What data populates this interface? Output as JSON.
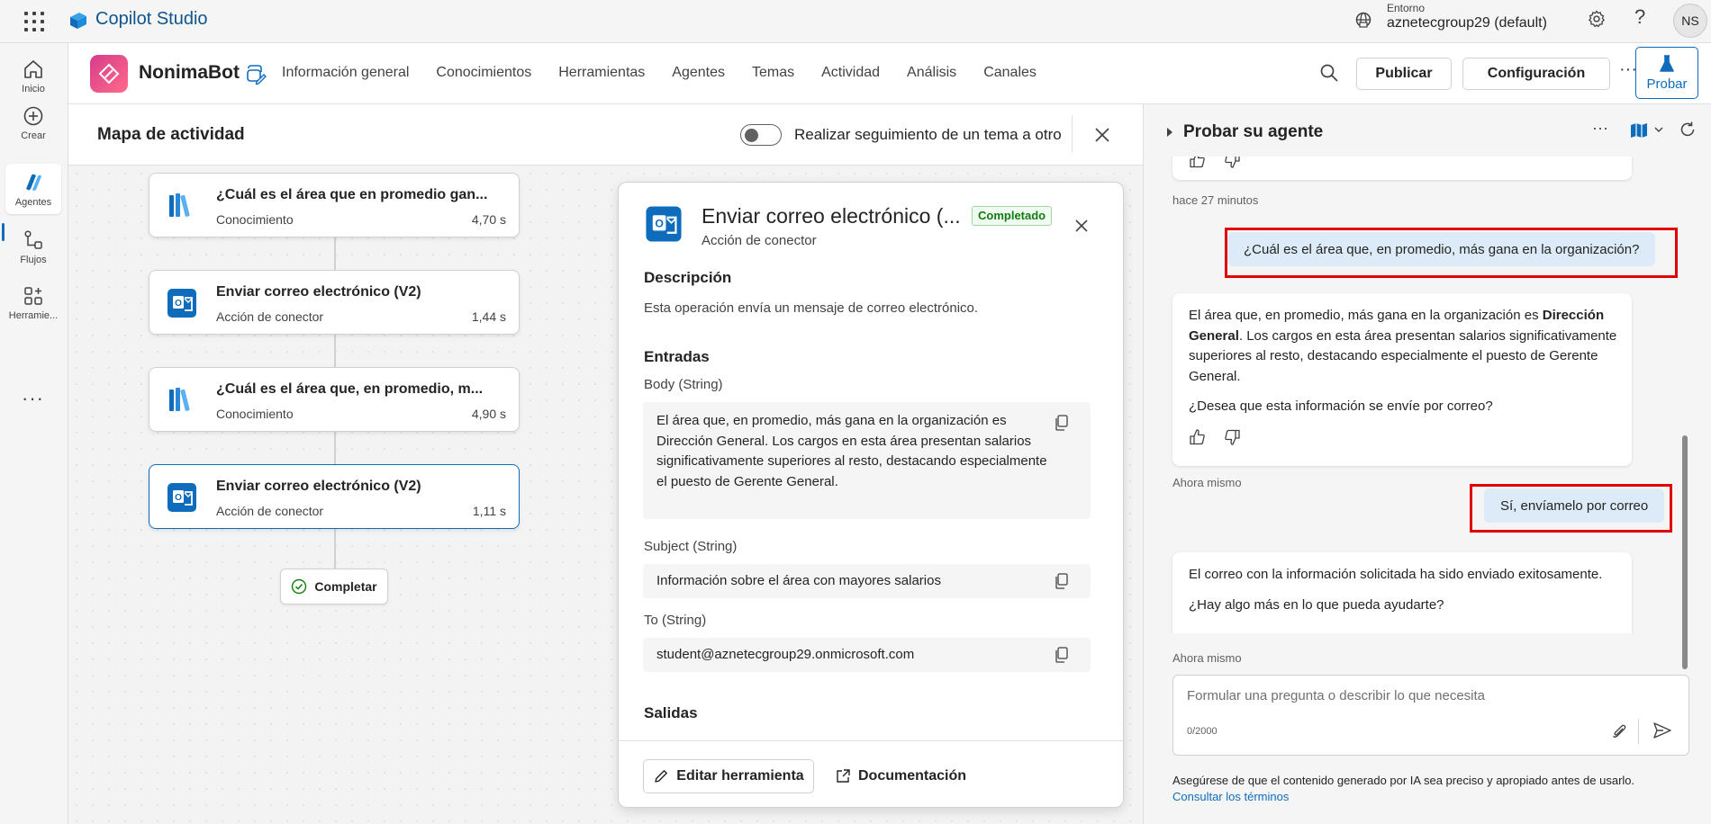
{
  "app": {
    "title": "Copilot Studio",
    "environment_label": "Entorno",
    "environment_value": "aznetecgroup29 (default)",
    "user_initials": "NS"
  },
  "rail": {
    "items": [
      {
        "label": "Inicio",
        "icon": "home-icon"
      },
      {
        "label": "Crear",
        "icon": "add-circle-icon"
      },
      {
        "label": "Agentes",
        "icon": "copilot-icon"
      },
      {
        "label": "Flujos",
        "icon": "flow-icon"
      },
      {
        "label": "Herramie...",
        "icon": "tools-icon"
      }
    ],
    "more": "···"
  },
  "agent": {
    "name": "NonimaBot",
    "nav": [
      "Información general",
      "Conocimientos",
      "Herramientas",
      "Agentes",
      "Temas",
      "Actividad",
      "Análisis",
      "Canales"
    ],
    "publish_label": "Publicar",
    "config_label": "Configuración",
    "more": "···",
    "test_label": "Probar"
  },
  "activity": {
    "title": "Mapa de actividad",
    "toggle_label": "Realizar seguimiento de un tema a otro",
    "toggle_on": false,
    "steps": [
      {
        "title": "¿Cuál es el área que en promedio gan...",
        "type": "Conocimiento",
        "time": "4,70 s",
        "icon": "knowledge-books-icon"
      },
      {
        "title": "Enviar correo electrónico (V2)",
        "type": "Acción de conector",
        "time": "1,44 s",
        "icon": "outlook-icon"
      },
      {
        "title": "¿Cuál es el área que, en promedio, m...",
        "type": "Conocimiento",
        "time": "4,90 s",
        "icon": "knowledge-books-icon"
      },
      {
        "title": "Enviar correo electrónico (V2)",
        "type": "Acción de conector",
        "time": "1,11 s",
        "icon": "outlook-icon"
      }
    ],
    "complete_label": "Completar"
  },
  "detail": {
    "title": "Enviar correo electrónico (...",
    "badge": "Completado",
    "subtitle": "Acción de conector",
    "description_heading": "Descripción",
    "description": "Esta operación envía un mensaje de correo electrónico.",
    "inputs_heading": "Entradas",
    "body_label": "Body (String)",
    "body_value": "El área que, en promedio, más gana en la organización es Dirección General. Los cargos en esta área presentan salarios significativamente superiores al resto, destacando especialmente el puesto de Gerente General.",
    "subject_label": "Subject (String)",
    "subject_value": "Información sobre el área con mayores salarios",
    "to_label": "To (String)",
    "to_value": "student@aznetecgroup29.onmicrosoft.com",
    "outputs_heading": "Salidas",
    "edit_label": "Editar herramienta",
    "docs_label": "Documentación"
  },
  "test": {
    "title": "Probar su agente",
    "ts1": "hace 27 minutos",
    "user_msg1": "¿Cuál es el área que, en promedio, más gana en la organización?",
    "bot1_p1_a": "El área que, en promedio, más gana en la organización es ",
    "bot1_p1_b": "Dirección General",
    "bot1_p1_c": ". Los cargos en esta área presentan salarios significativamente superiores al resto, destacando especialmente el puesto de Gerente General.",
    "bot1_p2": "¿Desea que esta información se envíe por correo?",
    "ts2": "Ahora mismo",
    "user_msg2": "Sí, envíamelo por correo",
    "bot2_p1": "El correo con la información solicitada ha sido enviado exitosamente.",
    "bot2_p2": "¿Hay algo más en lo que pueda ayudarte?",
    "ts3": "Ahora mismo",
    "composer_placeholder": "Formular una pregunta o describir lo que necesita",
    "char_count": "0/2000",
    "disclaimer": "Asegúrese de que el contenido generado por IA sea preciso y apropiado antes de usarlo.",
    "terms_link": "Consultar los términos"
  },
  "colors": {
    "accent": "#0f6cbd",
    "highlight_box": "#e00000",
    "user_bubble": "#dcebf7",
    "success": "#107c10"
  }
}
